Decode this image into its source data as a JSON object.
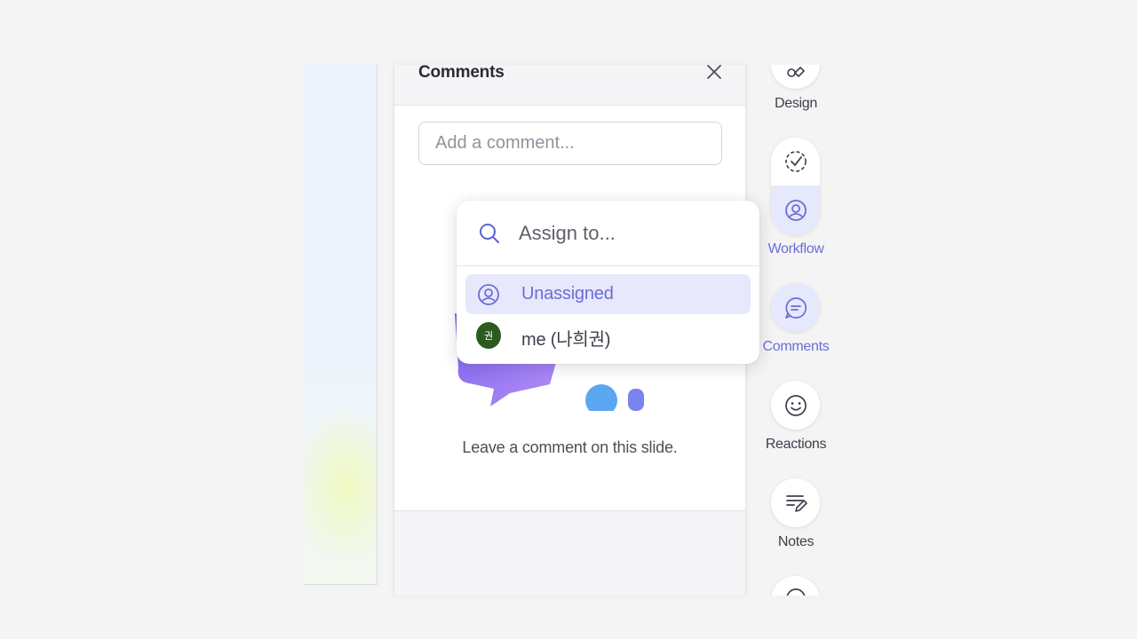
{
  "comments_panel": {
    "title": "Comments",
    "close_icon": "close-icon",
    "input_placeholder": "Add a comment...",
    "empty_message": "Leave a comment on this slide."
  },
  "assign_dropdown": {
    "search_placeholder": "Assign to...",
    "options": [
      {
        "label": "Unassigned",
        "icon": "user-circle-icon",
        "selected": true
      },
      {
        "label": "me (나희권)",
        "avatar_text": "권",
        "avatar_color": "#2d5a1e",
        "selected": false
      }
    ]
  },
  "tool_rail": {
    "items": [
      {
        "label": "Design",
        "icon": "design-tools-icon",
        "active": false
      },
      {
        "label": "Workflow",
        "icon": "workflow-icon",
        "active": true
      },
      {
        "label": "Comments",
        "icon": "comment-icon",
        "active": true
      },
      {
        "label": "Reactions",
        "icon": "smiley-icon",
        "active": false
      },
      {
        "label": "Notes",
        "icon": "notes-icon",
        "active": false
      }
    ]
  },
  "colors": {
    "accent": "#6a6ed6",
    "accent_bg": "#e7e8fb",
    "background": "#f4f4f5"
  }
}
